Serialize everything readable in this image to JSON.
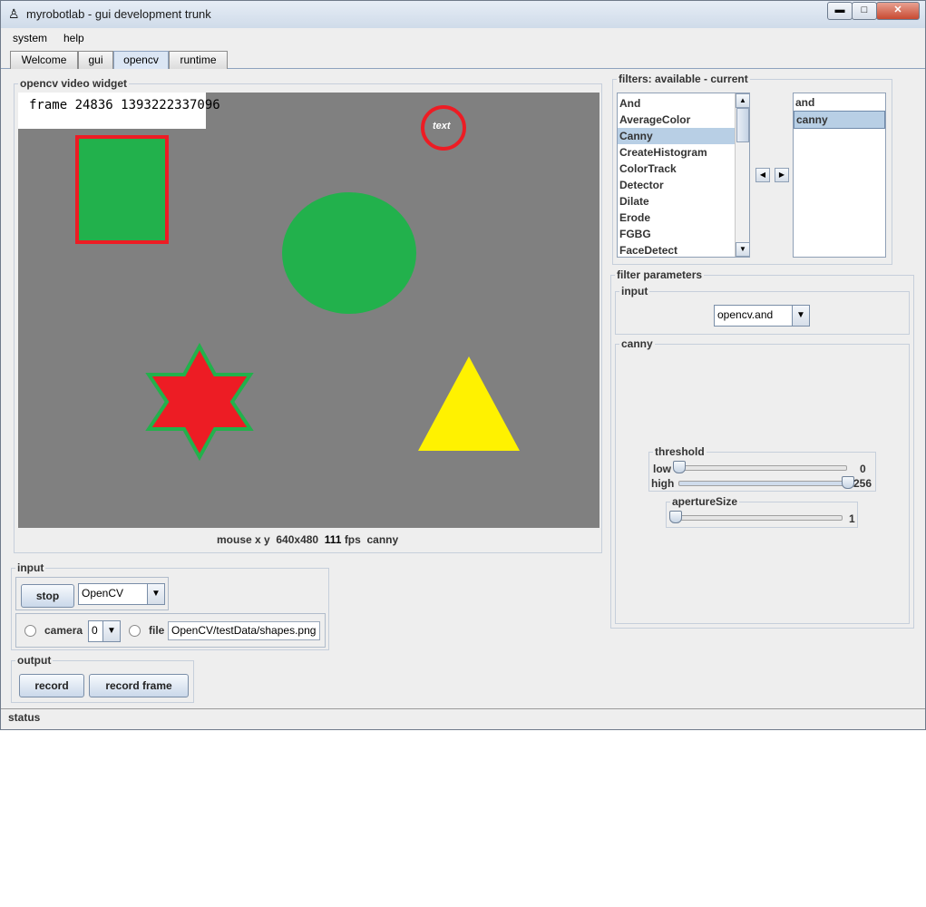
{
  "window": {
    "title": "myrobotlab - gui development trunk",
    "minimize": "▬",
    "maximize": "□",
    "close": "✕",
    "icon": "robot-icon"
  },
  "menu": [
    "system",
    "help"
  ],
  "tabs": [
    "Welcome",
    "gui",
    "opencv",
    "runtime"
  ],
  "video": {
    "legend": "opencv  video widget",
    "frame_text": "frame 24836 1393222337096",
    "circle_text": "text",
    "mouse_label": "mouse x y",
    "resolution": "640x480",
    "fps": "111",
    "fps_label": "fps",
    "filter": "canny"
  },
  "input": {
    "legend": "input",
    "stop": "stop",
    "source": "OpenCV",
    "camera_label": "camera",
    "camera_index": "0",
    "file_label": "file",
    "file_path": "OpenCV/testData/shapes.png"
  },
  "output": {
    "legend": "output",
    "record": "record",
    "record_frame": "record frame"
  },
  "statusbar": "status",
  "filters": {
    "legend": "filters: available - current",
    "available": [
      "And",
      "AverageColor",
      "Canny",
      "CreateHistogram",
      "ColorTrack",
      "Detector",
      "Dilate",
      "Erode",
      "FGBG",
      "FaceDetect"
    ],
    "available_selected": "Canny",
    "current": [
      "and",
      "canny"
    ],
    "current_selected": "canny"
  },
  "params": {
    "legend": "filter parameters",
    "input_legend": "input",
    "input_value": "opencv.and",
    "canny_legend": "canny",
    "threshold_legend": "threshold",
    "low_label": "low",
    "low_value": "0",
    "high_label": "high",
    "high_value": "256",
    "aperture_legend": "apertureSize",
    "aperture_value": "1"
  },
  "colors": {
    "shape_green": "#22b14c",
    "shape_red": "#ed1c24",
    "shape_yellow": "#fff200",
    "video_bg": "#808080"
  }
}
